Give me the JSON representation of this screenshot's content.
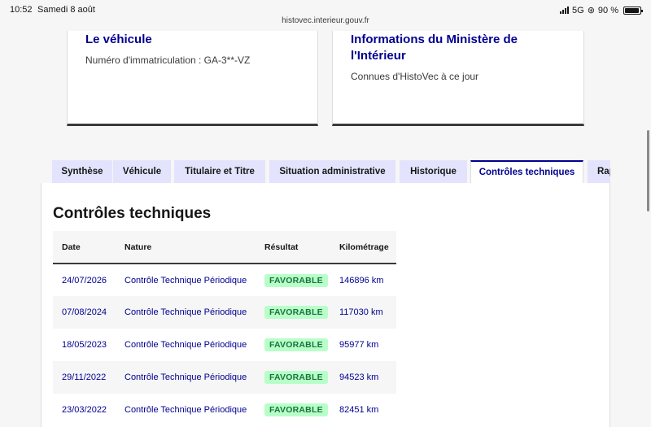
{
  "status_bar": {
    "time": "10:52",
    "date": "Samedi 8 août",
    "network": "5G",
    "battery": "90 %"
  },
  "url": "histovec.interieur.gouv.fr",
  "cards": {
    "vehicule": {
      "title": "Le véhicule",
      "text": "Numéro d'immatriculation : GA-3**-VZ"
    },
    "ministere": {
      "title": "Informations du Ministère de l'Intérieur",
      "text": "Connues d'HistoVec à ce jour"
    }
  },
  "tabs": [
    {
      "label": "Synthèse"
    },
    {
      "label": "Véhicule"
    },
    {
      "label": "Titulaire et Titre"
    },
    {
      "label": "Situation administrative"
    },
    {
      "label": "Historique"
    },
    {
      "label": "Contrôles techniques",
      "active": true
    },
    {
      "label": "Rapport"
    }
  ],
  "section_title": "Contrôles techniques",
  "table": {
    "headers": [
      "Date",
      "Nature",
      "Résultat",
      "Kilométrage"
    ],
    "rows": [
      {
        "date": "24/07/2026",
        "nature": "Contrôle Technique Périodique",
        "result": "FAVORABLE",
        "km": "146896 km"
      },
      {
        "date": "07/08/2024",
        "nature": "Contrôle Technique Périodique",
        "result": "FAVORABLE",
        "km": "117030 km"
      },
      {
        "date": "18/05/2023",
        "nature": "Contrôle Technique Périodique",
        "result": "FAVORABLE",
        "km": "95977 km"
      },
      {
        "date": "29/11/2022",
        "nature": "Contrôle Technique Périodique",
        "result": "FAVORABLE",
        "km": "94523 km"
      },
      {
        "date": "23/03/2022",
        "nature": "Contrôle Technique Périodique",
        "result": "FAVORABLE",
        "km": "82451 km"
      }
    ]
  },
  "colors": {
    "brand_blue": "#000091",
    "tab_bg": "#e3e3fd",
    "badge_bg": "#b8fec9",
    "badge_text": "#18753c"
  }
}
